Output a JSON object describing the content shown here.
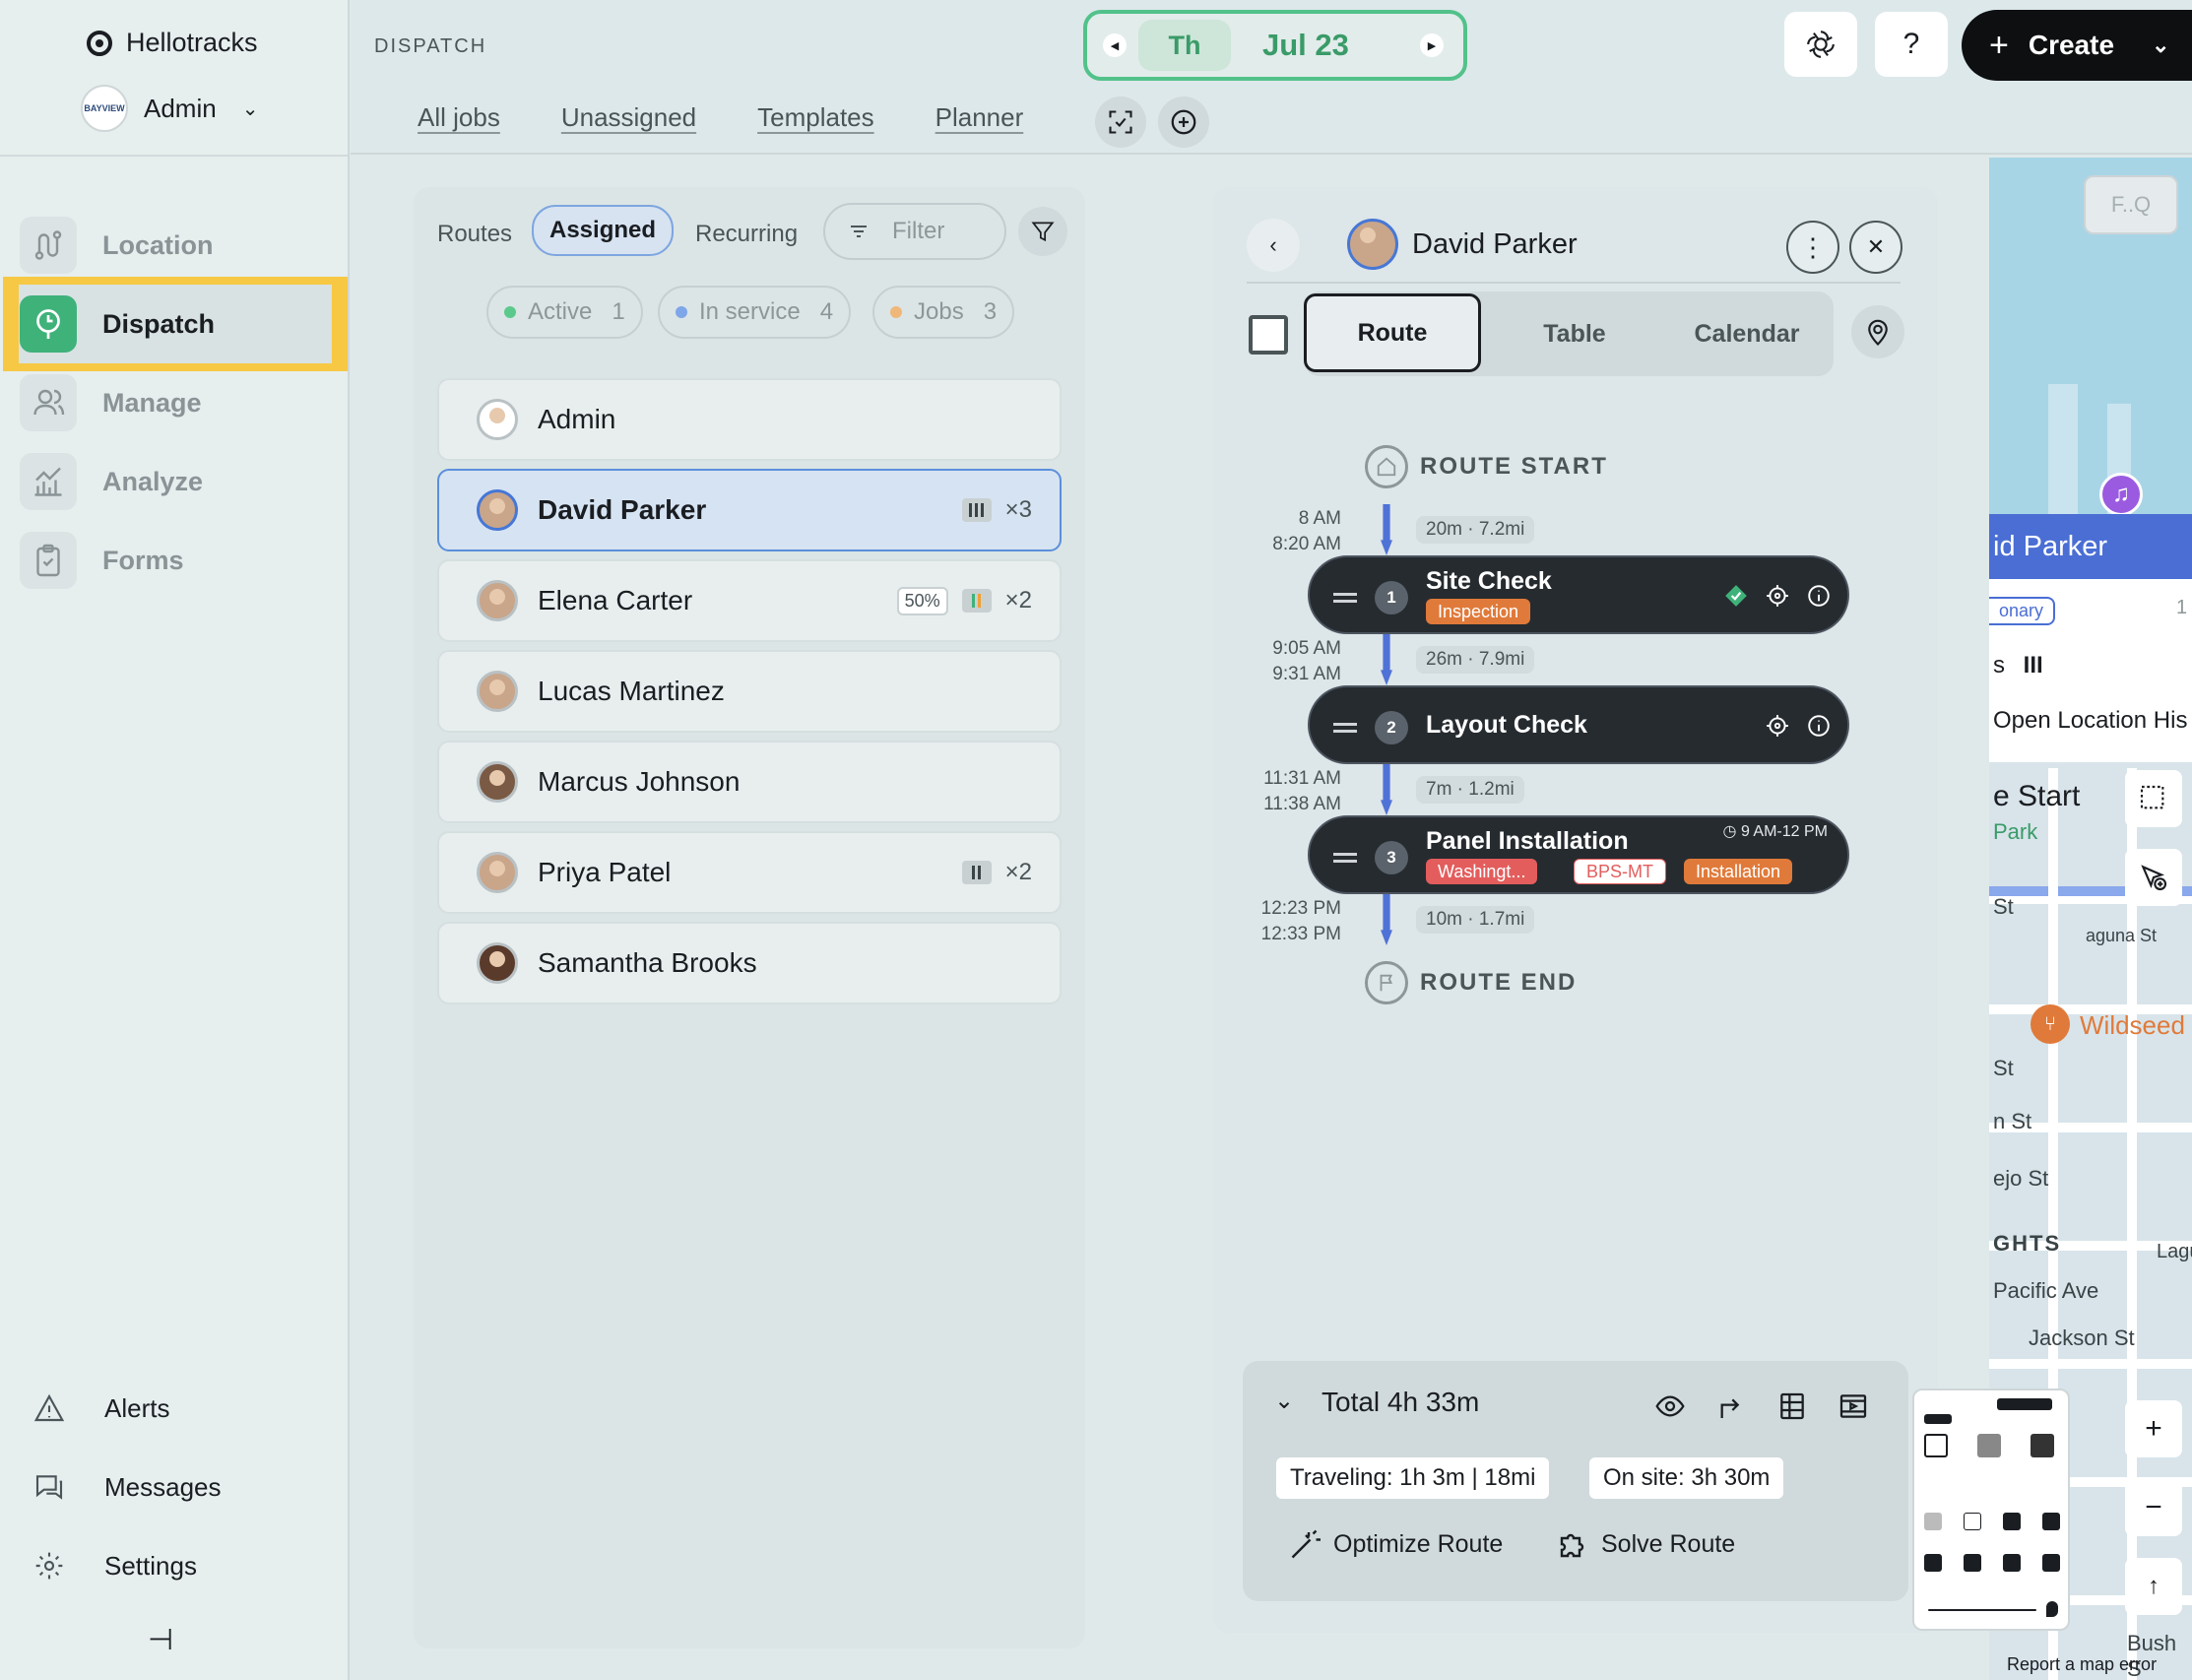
{
  "sidebar": {
    "brand": "Hellotracks",
    "account": {
      "name": "Admin",
      "avatar_text": "BAYVIEW"
    },
    "nav": [
      {
        "label": "Location",
        "icon": "location-route-icon",
        "active": false
      },
      {
        "label": "Dispatch",
        "icon": "dispatch-icon",
        "active": true
      },
      {
        "label": "Manage",
        "icon": "users-icon",
        "active": false
      },
      {
        "label": "Analyze",
        "icon": "analytics-icon",
        "active": false
      },
      {
        "label": "Forms",
        "icon": "clipboard-icon",
        "active": false
      }
    ],
    "bottom": [
      {
        "label": "Alerts",
        "icon": "warning-icon"
      },
      {
        "label": "Messages",
        "icon": "messages-icon"
      },
      {
        "label": "Settings",
        "icon": "gear-icon"
      }
    ],
    "pin_icon": "pin-sidebar-icon"
  },
  "header": {
    "section": "DISPATCH",
    "tabs": [
      "All jobs",
      "Unassigned",
      "Templates",
      "Planner"
    ],
    "date": {
      "day": "Th",
      "date": "Jul 23"
    },
    "help": "?",
    "create_label": "Create"
  },
  "routes": {
    "segments": {
      "routes": "Routes",
      "assigned": "Assigned",
      "recurring": "Recurring"
    },
    "filter_placeholder": "Filter",
    "chips": [
      {
        "label": "Active",
        "count": "1",
        "color": "#5cc98c"
      },
      {
        "label": "In service",
        "count": "4",
        "color": "#7ea6e8"
      },
      {
        "label": "Jobs",
        "count": "3",
        "color": "#f0b77a"
      }
    ],
    "people": [
      {
        "name": "Admin",
        "badge": "",
        "pct": "",
        "count": ""
      },
      {
        "name": "David Parker",
        "badge": "bars",
        "pct": "",
        "count": "×3",
        "selected": true
      },
      {
        "name": "Elena Carter",
        "badge": "bars",
        "pct": "50%",
        "count": "×2"
      },
      {
        "name": "Lucas Martinez",
        "badge": "",
        "pct": "",
        "count": ""
      },
      {
        "name": "Marcus Johnson",
        "badge": "",
        "pct": "",
        "count": ""
      },
      {
        "name": "Priya Patel",
        "badge": "bars",
        "pct": "",
        "count": "×2"
      },
      {
        "name": "Samantha Brooks",
        "badge": "",
        "pct": "",
        "count": ""
      }
    ]
  },
  "detail": {
    "name": "David Parker",
    "view_tabs": [
      "Route",
      "Table",
      "Calendar"
    ],
    "route_start": "ROUTE START",
    "route_end": "ROUTE END",
    "legs": [
      {
        "times": [
          "8 AM",
          "8:20 AM"
        ],
        "travel": "20m · 7.2mi"
      },
      {
        "times": [
          "9:05 AM",
          "9:31 AM"
        ],
        "travel": "26m · 7.9mi"
      },
      {
        "times": [
          "11:31 AM",
          "11:38 AM"
        ],
        "travel": "7m · 1.2mi"
      },
      {
        "times": [
          "12:23 PM",
          "12:33 PM"
        ],
        "travel": "10m · 1.7mi"
      }
    ],
    "stops": [
      {
        "num": "1",
        "title": "Site Check",
        "tags": [
          {
            "label": "Inspection",
            "color": "#e07a3a"
          }
        ]
      },
      {
        "num": "2",
        "title": "Layout Check",
        "tags": []
      },
      {
        "num": "3",
        "title": "Panel Installation",
        "time_window": "9 AM-12 PM",
        "tags": [
          {
            "label": "Washingt...",
            "color": "#e35d5d"
          },
          {
            "label": "BPS-MT",
            "color": "#ffffff"
          },
          {
            "label": "Installation",
            "color": "#e07a3a"
          }
        ]
      }
    ],
    "summary": {
      "total": "Total 4h 33m",
      "traveling": "Traveling: 1h 3m | 18mi",
      "on_site": "On site: 3h 30m",
      "optimize": "Optimize Route",
      "solve": "Solve Route"
    }
  },
  "map": {
    "search_placeholder": "F..Q",
    "card_name": "id Parker",
    "card_tag": "onary",
    "card_count": "1",
    "card_line2": "s",
    "card_link": "Open Location His",
    "labels": [
      "e Start",
      "Park",
      "St",
      "Wildseed",
      "St",
      "n St",
      "ejo St",
      "GHTS",
      "Pacific Ave",
      "Jackson St",
      "aguna St",
      "Laguna",
      "Bush S"
    ],
    "report": "Report a map error"
  }
}
